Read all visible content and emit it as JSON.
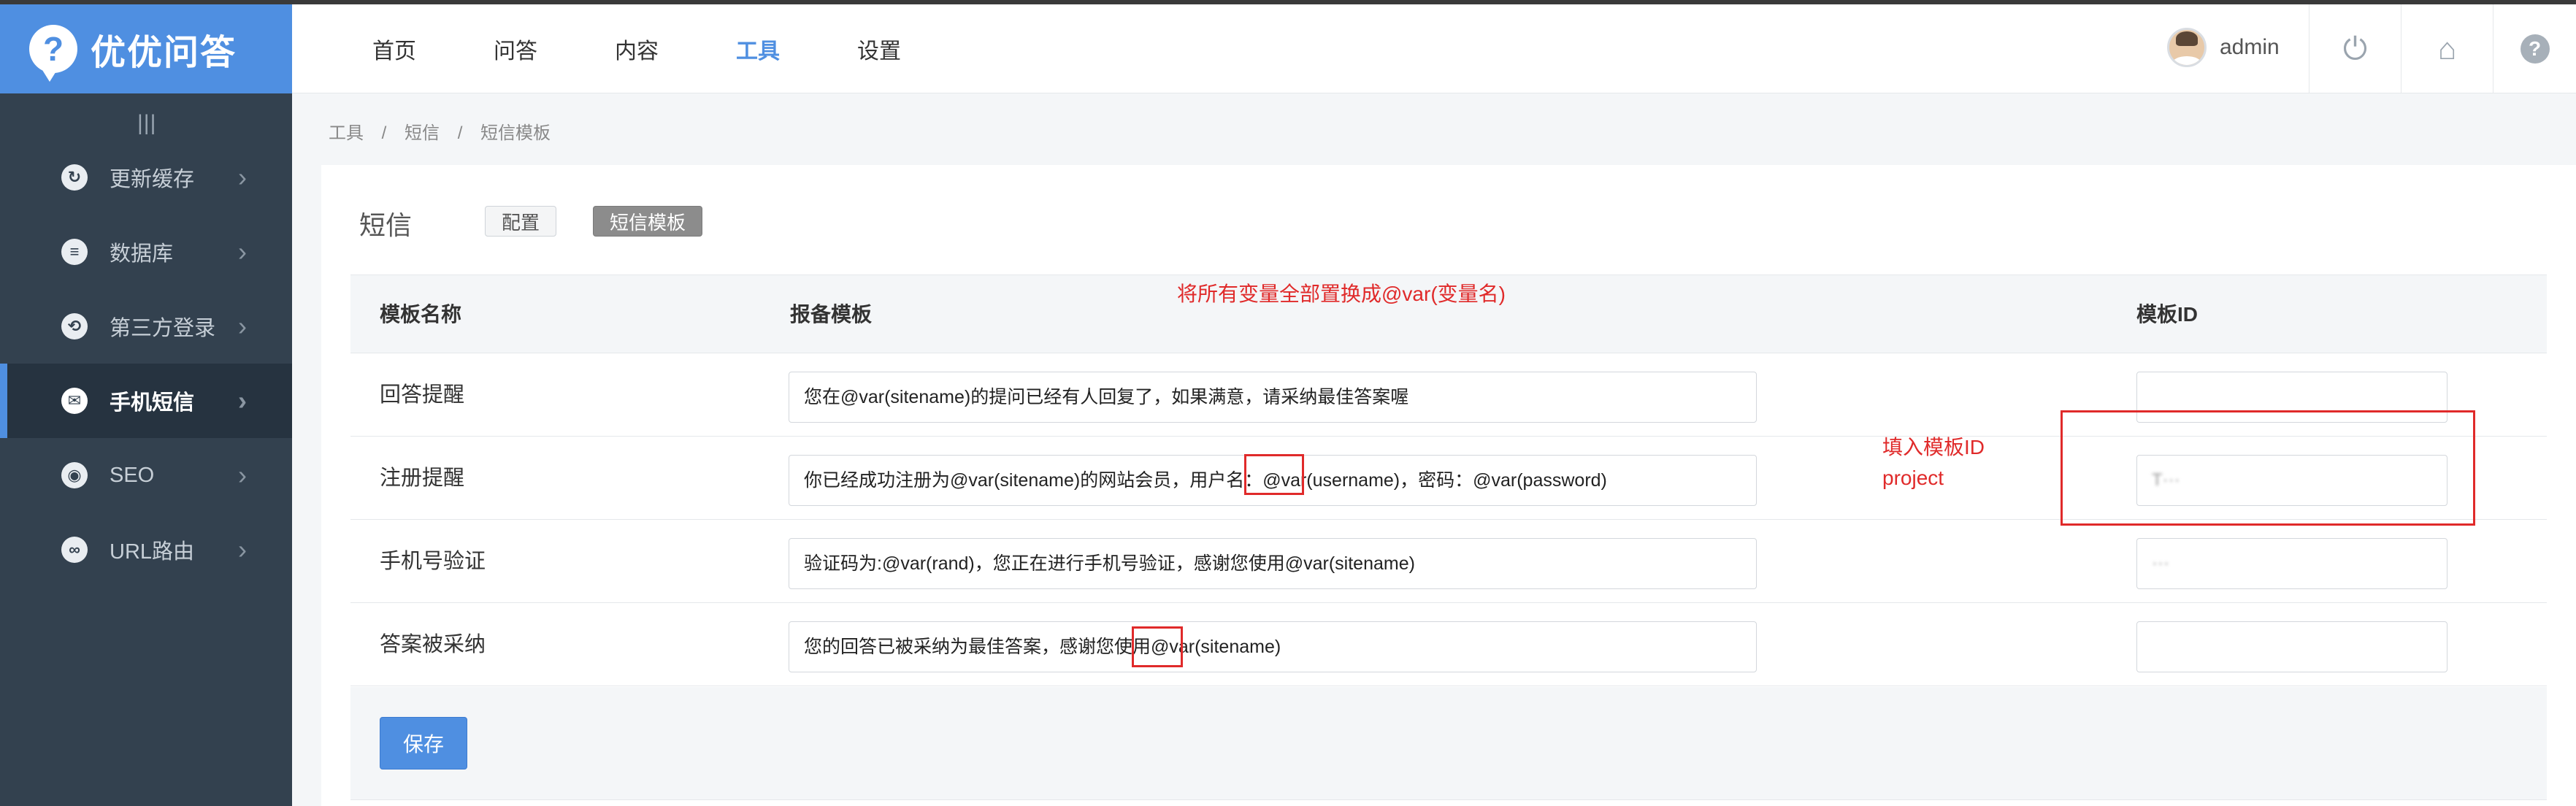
{
  "app": {
    "logo_mark": "?",
    "logo_text": "优优问答"
  },
  "sidebar": {
    "collapse_handle": "|||",
    "items": [
      {
        "label": "更新缓存",
        "icon": "refresh-icon",
        "glyph": "↻",
        "chevron": "›"
      },
      {
        "label": "数据库",
        "icon": "database-icon",
        "glyph": "≡",
        "chevron": "›"
      },
      {
        "label": "第三方登录",
        "icon": "share-icon",
        "glyph": "⟲",
        "chevron": "›"
      },
      {
        "label": "手机短信",
        "icon": "message-icon",
        "glyph": "✉",
        "chevron": "›",
        "active": true
      },
      {
        "label": "SEO",
        "icon": "target-icon",
        "glyph": "◉",
        "chevron": "›"
      },
      {
        "label": "URL路由",
        "icon": "link-icon",
        "glyph": "∞",
        "chevron": "›"
      }
    ]
  },
  "header": {
    "nav": [
      "首页",
      "问答",
      "内容",
      "工具",
      "设置"
    ],
    "active_nav": "工具",
    "username": "admin",
    "icons": {
      "power": "⏻",
      "home": "⌂",
      "help": "?"
    }
  },
  "breadcrumb": [
    "工具",
    "/",
    "短信",
    "/",
    "短信模板"
  ],
  "panel": {
    "title": "短信",
    "tabs": [
      "配置",
      "短信模板"
    ],
    "active_tab": "短信模板"
  },
  "table": {
    "headers": [
      "模板名称",
      "报备模板",
      "模板ID"
    ],
    "rows": [
      {
        "name": "回答提醒",
        "template": "您在@var(sitename)的提问已经有人回复了，如果满意，请采纳最佳答案喔",
        "template_id": ""
      },
      {
        "name": "注册提醒",
        "template": "你已经成功注册为@var(sitename)的网站会员，用户名：@var(username)，密码：@var(password)",
        "template_id": "T···"
      },
      {
        "name": "手机号验证",
        "template": "验证码为:@var(rand)，您正在进行手机号验证，感谢您使用@var(sitename)",
        "template_id": "···"
      },
      {
        "name": "答案被采纳",
        "template": "您的回答已被采纳为最佳答案，感谢您使用@var(sitename)",
        "template_id": ""
      }
    ]
  },
  "actions": {
    "save_label": "保存"
  },
  "annotations": {
    "header_note": "将所有变量全部置换成@var(变量名)",
    "id_note_line1": "填入模板ID",
    "id_note_line2": "project",
    "color": "#e02a2a"
  },
  "colors": {
    "accent": "#4f8fe1",
    "sidebar_bg": "#33414f",
    "sidebar_active_bg": "#263340"
  }
}
